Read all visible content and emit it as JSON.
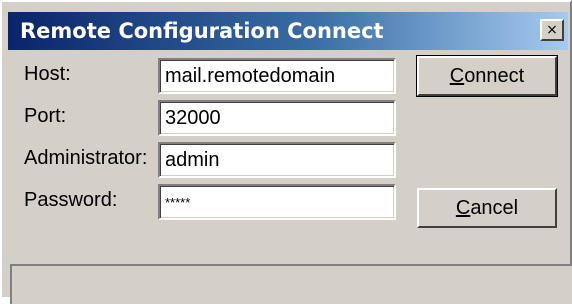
{
  "window": {
    "title": "Remote Configuration Connect",
    "close_glyph": "×"
  },
  "form": {
    "host_label": "Host:",
    "host_value": "mail.remotedomain",
    "port_label": "Port:",
    "port_value": "32000",
    "admin_label": "Administrator:",
    "admin_value": "admin",
    "password_label": "Password:",
    "password_value": "*****"
  },
  "buttons": {
    "connect_first": "C",
    "connect_rest": "onnect",
    "cancel_first": "C",
    "cancel_rest": "ancel"
  },
  "status": {
    "text": ""
  },
  "colors": {
    "title_start": "#0a246a",
    "title_end": "#a6caf0",
    "face": "#d4d0c8"
  },
  "icons": {
    "close": "close-icon"
  }
}
